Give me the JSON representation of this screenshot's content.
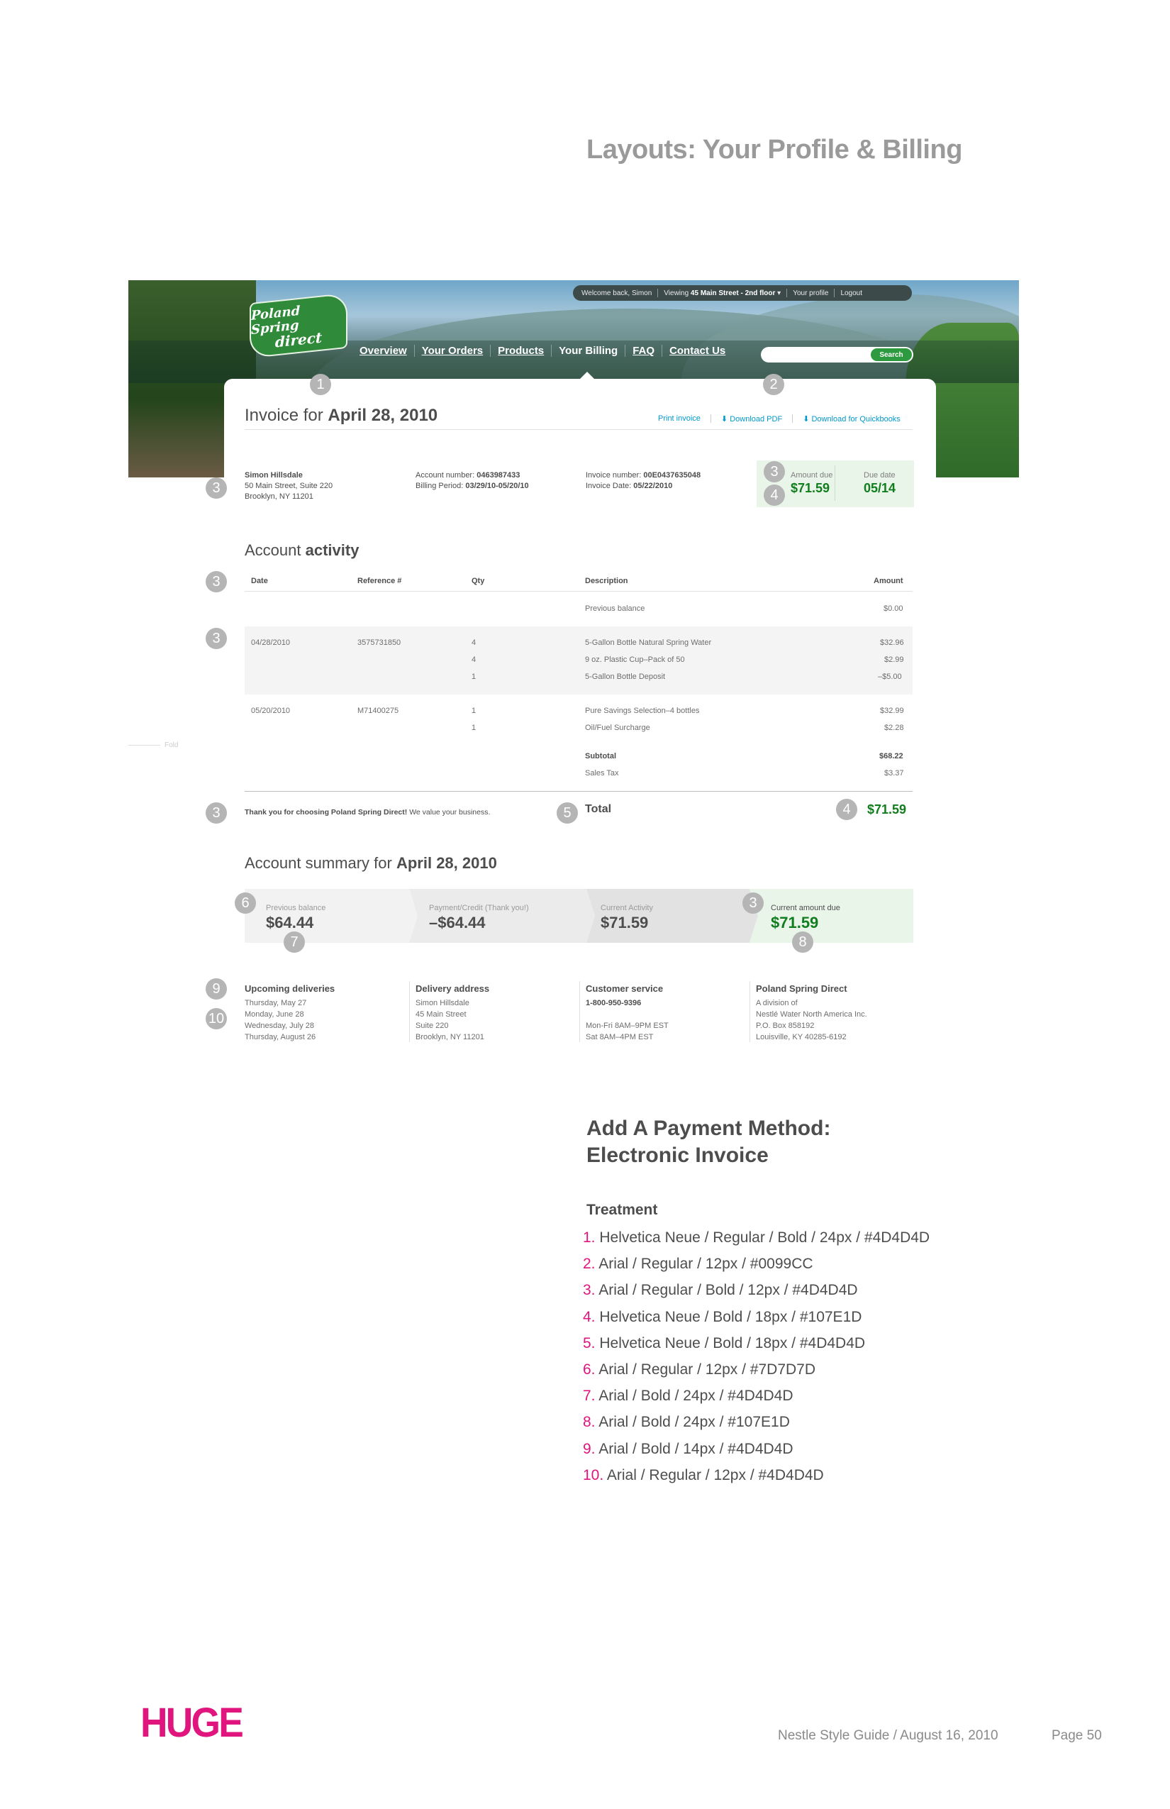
{
  "page": {
    "title": "Layouts: Your Profile & Billing",
    "footer_doc": "Nestle Style Guide / August 16, 2010",
    "footer_page": "Page 50",
    "brand_logo": "HUGE",
    "fold_label": "Fold"
  },
  "site": {
    "logo_line1": "Poland Spring",
    "logo_line2": "direct",
    "topbar": {
      "welcome": "Welcome back, Simon",
      "viewing_prefix": "Viewing",
      "viewing_value": "45 Main Street - 2nd floor",
      "profile": "Your profile",
      "logout": "Logout"
    },
    "nav": [
      "Overview",
      "Your Orders",
      "Products",
      "Your Billing",
      "FAQ",
      "Contact Us"
    ],
    "search_button": "Search"
  },
  "invoice": {
    "title_prefix": "Invoice for",
    "title_date": "April 28, 2010",
    "links": [
      "Print invoice",
      "Download PDF",
      "Download for Quickbooks"
    ],
    "customer_name": "Simon Hillsdale",
    "customer_addr1": "50 Main Street, Suite 220",
    "customer_addr2": "Brooklyn, NY 11201",
    "account_label": "Account number:",
    "account_value": "0463987433",
    "billing_label": "Billing Period:",
    "billing_value": "03/29/10-05/20/10",
    "invoice_no_label": "Invoice number:",
    "invoice_no_value": "00E0437635048",
    "invoice_date_label": "Invoice Date:",
    "invoice_date_value": "05/22/2010",
    "amount_due_label": "Amount due",
    "amount_due_value": "$71.59",
    "due_date_label": "Due date",
    "due_date_value": "05/14"
  },
  "activity": {
    "title_prefix": "Account",
    "title_bold": "activity",
    "headers": [
      "Date",
      "Reference #",
      "Qty",
      "Description",
      "Amount"
    ],
    "previous_balance_label": "Previous balance",
    "previous_balance_value": "$0.00",
    "rows": [
      {
        "date": "04/28/2010",
        "ref": "3575731850",
        "qty": "4",
        "desc": "5-Gallon Bottle Natural Spring Water",
        "amount": "$32.96"
      },
      {
        "date": "",
        "ref": "",
        "qty": "4",
        "desc": "9 oz. Plastic Cup–Pack of 50",
        "amount": "$2.99"
      },
      {
        "date": "",
        "ref": "",
        "qty": "1",
        "desc": "5-Gallon Bottle Deposit",
        "amount": "–$5.00"
      },
      {
        "date": "05/20/2010",
        "ref": "M71400275",
        "qty": "1",
        "desc": "Pure Savings Selection–4 bottles",
        "amount": "$32.99"
      },
      {
        "date": "",
        "ref": "",
        "qty": "1",
        "desc": "Oil/Fuel Surcharge",
        "amount": "$2.28"
      }
    ],
    "subtotal_label": "Subtotal",
    "subtotal_value": "$68.22",
    "tax_label": "Sales Tax",
    "tax_value": "$3.37",
    "thanks_bold": "Thank you for choosing Poland Spring Direct!",
    "thanks_rest": "We value your business.",
    "total_label": "Total",
    "total_value": "$71.59"
  },
  "summary": {
    "title_prefix": "Account summary for",
    "title_date": "April 28, 2010",
    "segments": [
      {
        "label": "Previous balance",
        "value": "$64.44"
      },
      {
        "label": "Payment/Credit (Thank you!)",
        "value": "–$64.44"
      },
      {
        "label": "Current Activity",
        "value": "$71.59"
      },
      {
        "label": "Current amount due",
        "value": "$71.59"
      }
    ]
  },
  "info": [
    {
      "heading": "Upcoming deliveries",
      "lines": "Thursday, May 27\nMonday, June 28\nWednesday, July 28\nThursday, August 26"
    },
    {
      "heading": "Delivery address",
      "lines": "Simon Hillsdale\n45 Main Street\nSuite 220\nBrooklyn, NY 11201"
    },
    {
      "heading": "Customer service",
      "phone": "1-800-950-9396",
      "lines": "\nMon-Fri 8AM–9PM EST\nSat 8AM–4PM EST"
    },
    {
      "heading": "Poland Spring Direct",
      "lines": "A division of\nNestlé Water North America Inc.\nP.O. Box 858192\nLouisville, KY 40285-6192"
    }
  ],
  "markers": [
    "1",
    "2",
    "3",
    "4",
    "5",
    "6",
    "7",
    "8",
    "9",
    "10"
  ],
  "treatment": {
    "section_title": "Add A Payment Method:\nElectronic Invoice",
    "heading": "Treatment",
    "items": [
      {
        "num": "1.",
        "text": "Helvetica Neue / Regular / Bold / 24px / #4D4D4D"
      },
      {
        "num": "2.",
        "text": "Arial / Regular / 12px / #0099CC"
      },
      {
        "num": "3.",
        "text": "Arial / Regular / Bold / 12px / #4D4D4D"
      },
      {
        "num": "4.",
        "text": "Helvetica Neue / Bold / 18px / #107E1D"
      },
      {
        "num": "5.",
        "text": "Helvetica Neue / Bold / 18px / #4D4D4D"
      },
      {
        "num": "6.",
        "text": "Arial / Regular / 12px / #7D7D7D"
      },
      {
        "num": "7.",
        "text": "Arial / Bold / 24px / #4D4D4D"
      },
      {
        "num": "8.",
        "text": "Arial / Bold / 24px / #107E1D"
      },
      {
        "num": "9.",
        "text": "Arial / Bold / 14px / #4D4D4D"
      },
      {
        "num": "10.",
        "text": "Arial / Regular / 12px / #4D4D4D"
      }
    ]
  },
  "colors": {
    "accent_pink": "#E0157D",
    "green": "#107E1D",
    "text": "#4D4D4D",
    "link_blue": "#0099CC"
  }
}
